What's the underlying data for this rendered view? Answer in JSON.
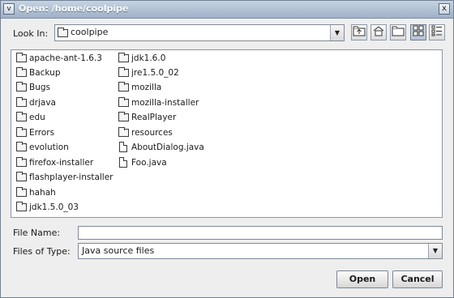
{
  "window": {
    "title": "Open:  /home/coolpipe",
    "menu_glyph": "v",
    "close_glyph": "x"
  },
  "lookin": {
    "label": "Look In:",
    "value": "coolpipe"
  },
  "toolbar": [
    "up-folder",
    "home-folder",
    "new-folder",
    "list-view",
    "details-view"
  ],
  "files": {
    "col1": [
      "apache-ant-1.6.3",
      "Backup",
      "Bugs",
      "drjava",
      "edu",
      "Errors",
      "evolution",
      "firefox-installer",
      "flashplayer-installer",
      "hahah",
      "jdk1.5.0_03"
    ],
    "col2": [
      "jdk1.6.0",
      "jre1.5.0_02",
      "mozilla",
      "mozilla-installer",
      "RealPlayer",
      "resources",
      "AboutDialog.java",
      "Foo.java"
    ],
    "col2_types": [
      "folder",
      "folder",
      "folder",
      "folder",
      "folder",
      "folder",
      "file",
      "file"
    ]
  },
  "filename": {
    "label": "File Name:",
    "value": ""
  },
  "filetype": {
    "label": "Files of Type:",
    "value": "Java source files"
  },
  "buttons": {
    "open": "Open",
    "cancel": "Cancel"
  }
}
